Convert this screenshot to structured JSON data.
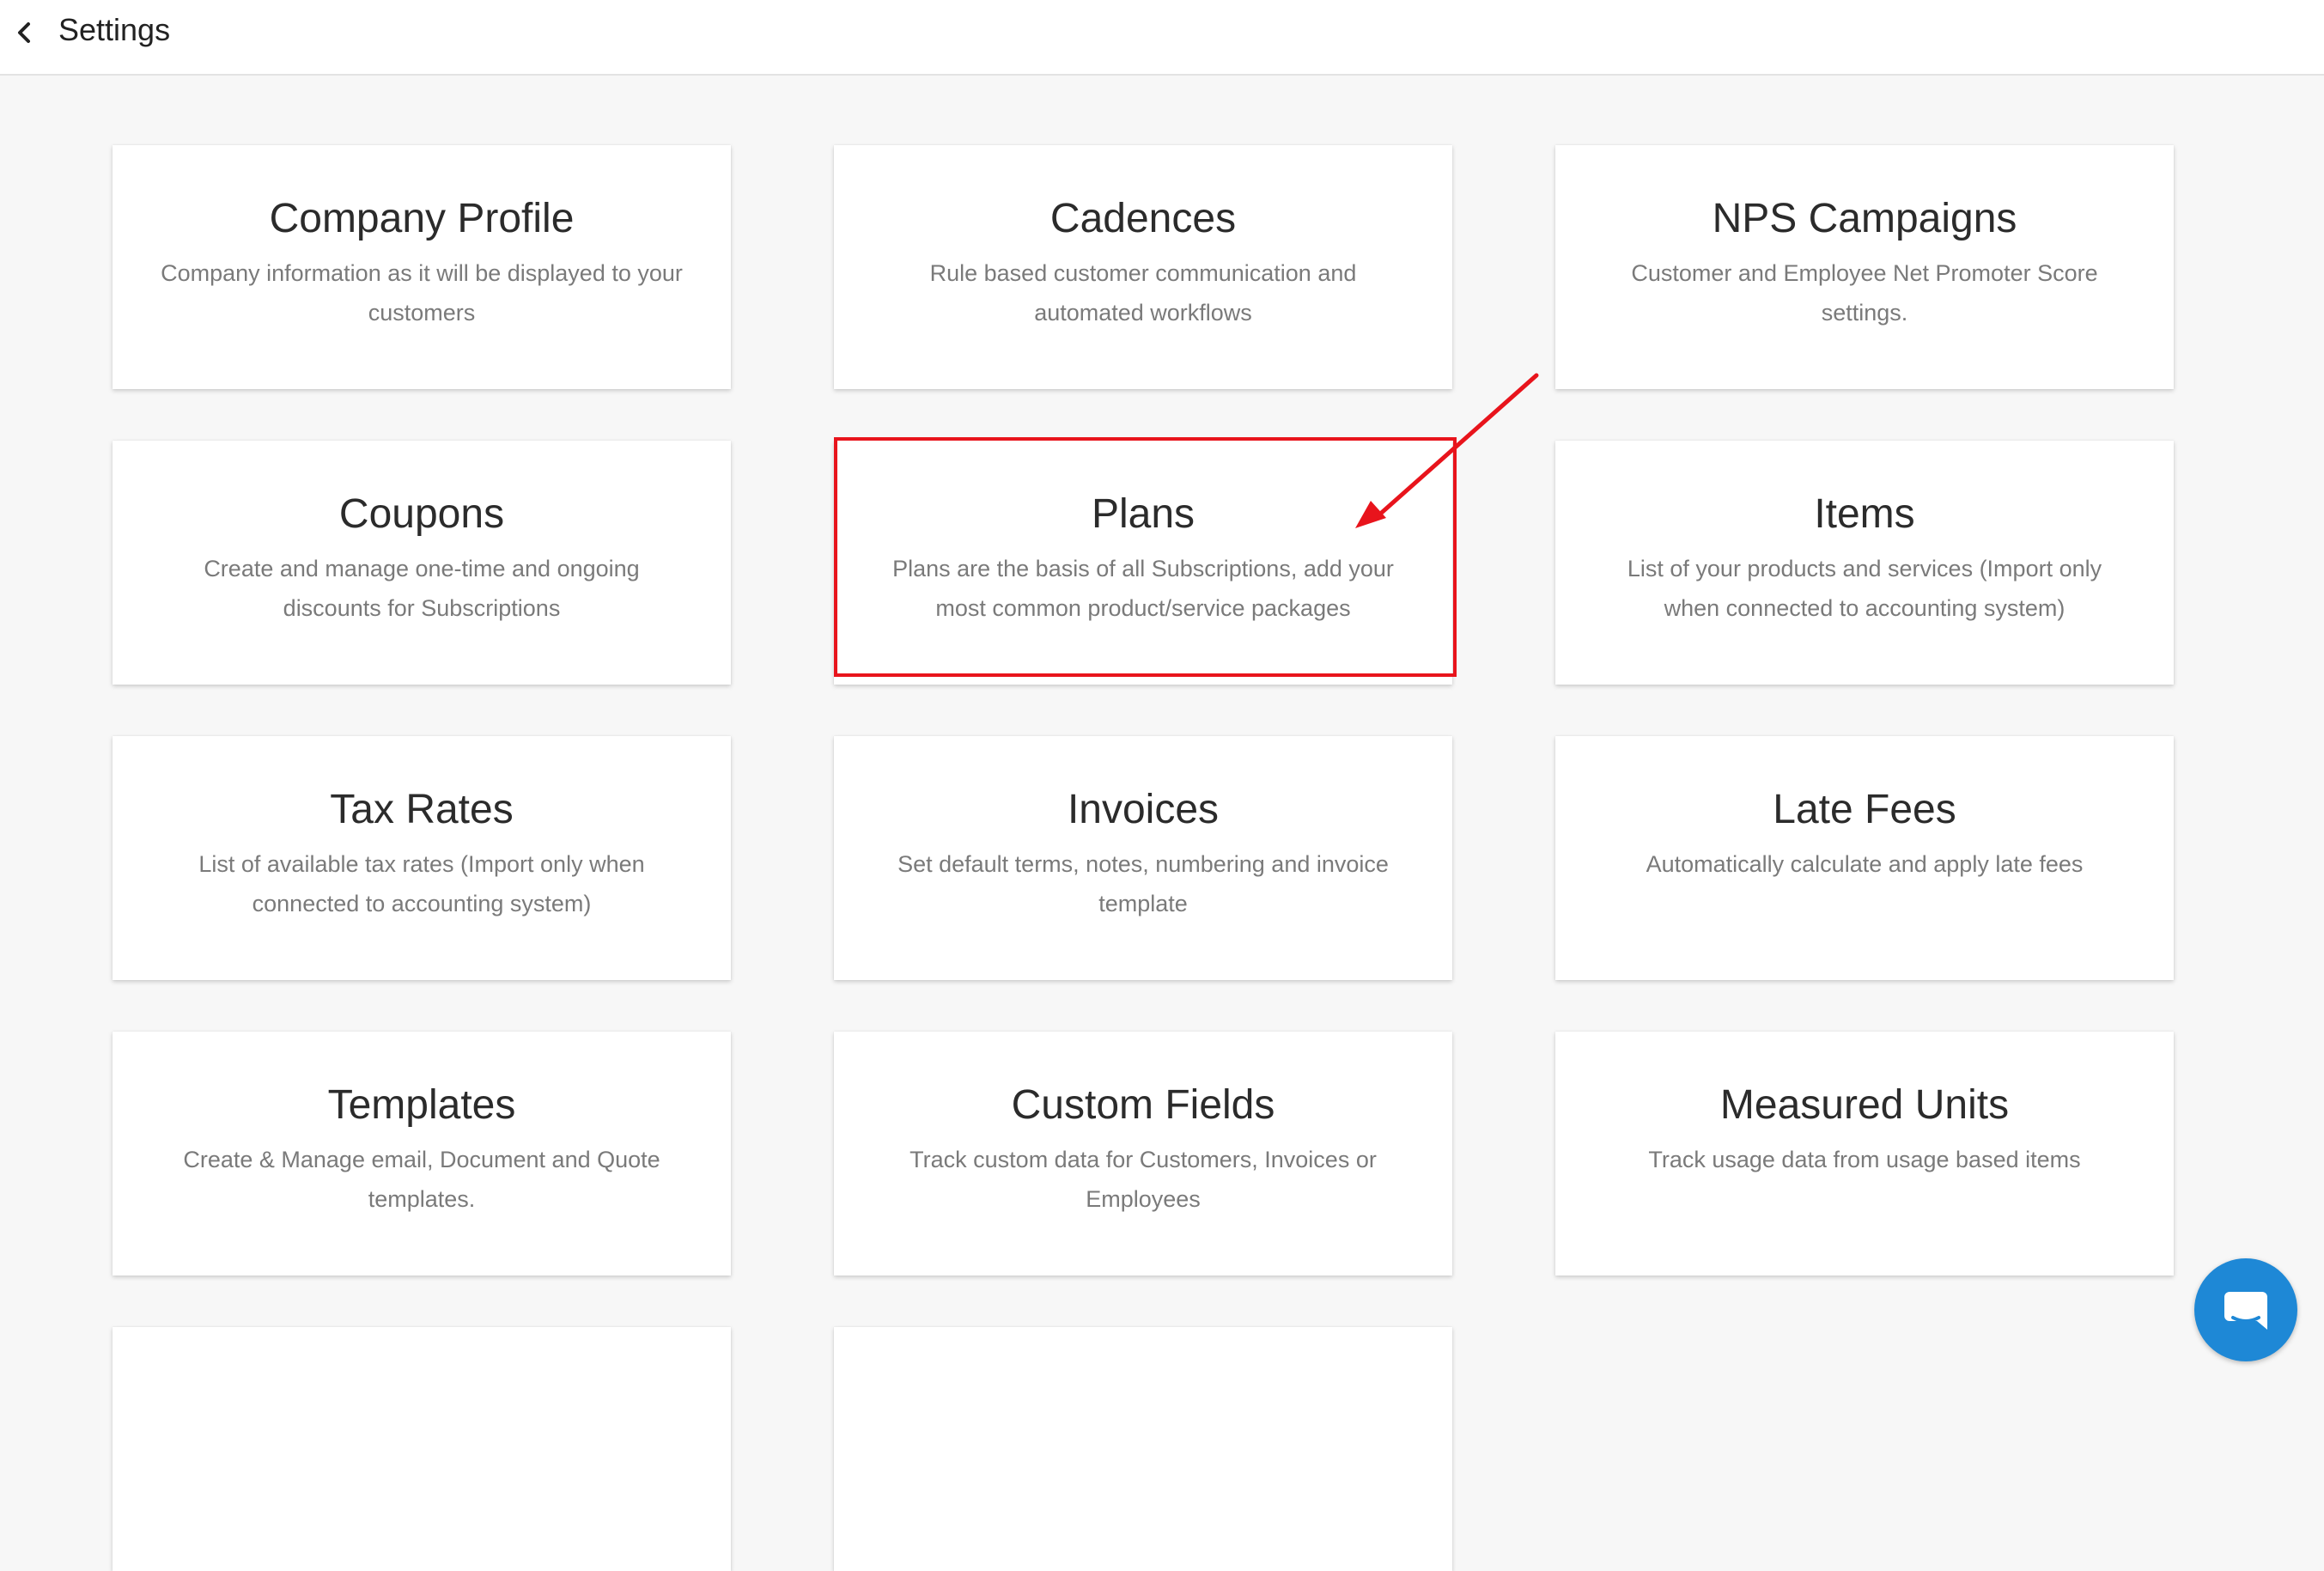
{
  "header": {
    "title": "Settings"
  },
  "cards": [
    {
      "title": "Company Profile",
      "description": "Company information as it will be displayed to your customers"
    },
    {
      "title": "Cadences",
      "description": "Rule based customer communication and automated workflows"
    },
    {
      "title": "NPS Campaigns",
      "description": "Customer and Employee Net Promoter Score settings."
    },
    {
      "title": "Coupons",
      "description": "Create and manage one-time and ongoing discounts for Subscriptions"
    },
    {
      "title": "Plans",
      "description": "Plans are the basis of all Subscriptions, add your most common product/service packages"
    },
    {
      "title": "Items",
      "description": "List of your products and services (Import only when connected to accounting system)"
    },
    {
      "title": "Tax Rates",
      "description": "List of available tax rates (Import only when connected to accounting system)"
    },
    {
      "title": "Invoices",
      "description": "Set default terms, notes, numbering and invoice template"
    },
    {
      "title": "Late Fees",
      "description": "Automatically calculate and apply late fees"
    },
    {
      "title": "Templates",
      "description": "Create & Manage email, Document and Quote templates."
    },
    {
      "title": "Custom Fields",
      "description": "Track custom data for Customers, Invoices or Employees"
    },
    {
      "title": "Measured Units",
      "description": "Track usage data from usage based items"
    }
  ],
  "colors": {
    "highlight": "#e8141c",
    "chat_button": "#1e88d6"
  },
  "icons": {
    "back": "chevron-left-icon",
    "chat": "chat-bubble-icon"
  }
}
